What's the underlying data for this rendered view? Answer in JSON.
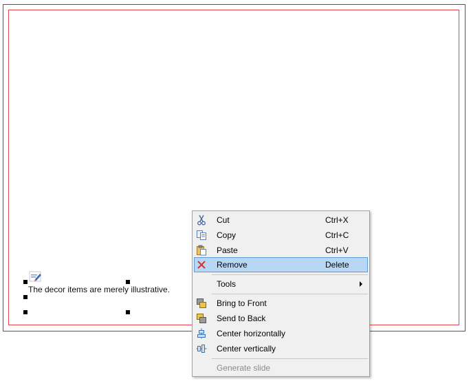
{
  "canvas": {
    "text_item": "The decor items are merely illustrative."
  },
  "context_menu": {
    "items": [
      {
        "label": "Cut",
        "shortcut": "Ctrl+X",
        "icon": "scissors-icon"
      },
      {
        "label": "Copy",
        "shortcut": "Ctrl+C",
        "icon": "copy-icon"
      },
      {
        "label": "Paste",
        "shortcut": "Ctrl+V",
        "icon": "paste-icon"
      },
      {
        "label": "Remove",
        "shortcut": "Delete",
        "icon": "remove-x-icon",
        "highlighted": true
      },
      {
        "label": "Tools",
        "submenu": true
      },
      {
        "label": "Bring to Front",
        "icon": "bring-to-front-icon"
      },
      {
        "label": "Send to Back",
        "icon": "send-to-back-icon"
      },
      {
        "label": "Center horizontally",
        "icon": "center-horizontally-icon"
      },
      {
        "label": "Center vertically",
        "icon": "center-vertically-icon"
      },
      {
        "label": "Generate slide",
        "disabled": true
      }
    ]
  },
  "colors": {
    "safe_area_border": "#e8424a",
    "highlight_bg": "#b7d7f4",
    "highlight_border": "#5c9ad6",
    "menu_bg": "#f0f0f0"
  }
}
